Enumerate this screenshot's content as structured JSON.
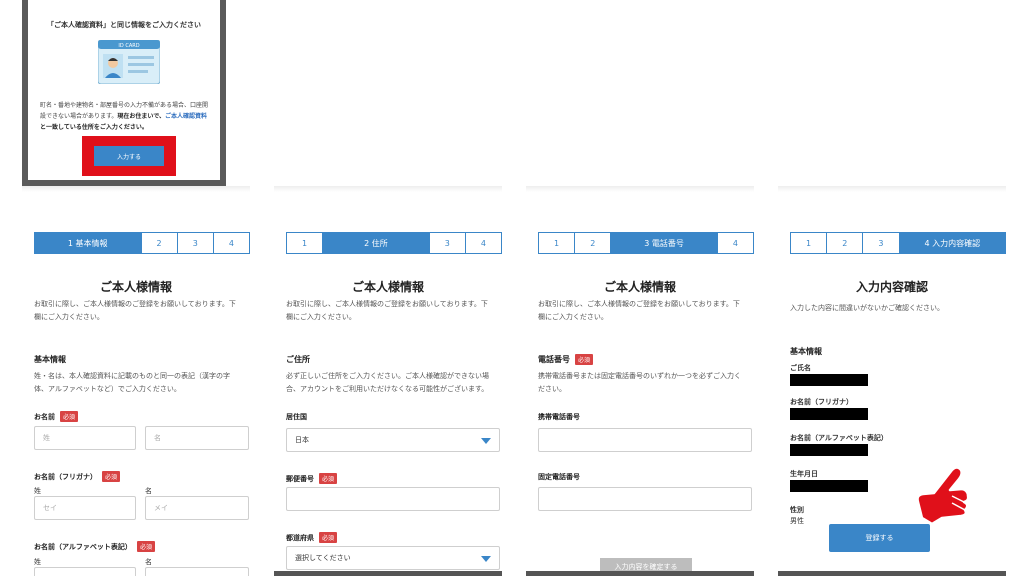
{
  "modal": {
    "title": "「ご本人確認資料」と同じ情報をご入力ください",
    "card_label": "ID CARD",
    "text_1": "町名・番地や建物名・部屋番号の入力不備がある場合、口座開設できない場合があります。",
    "text_bold": "現在お住まいで、",
    "text_blue": "ご本人確認資料",
    "text_bold_2": "と一致している住所をご入力ください。",
    "button": "入力する"
  },
  "panel1": {
    "steps": [
      "1 基本情報",
      "2",
      "3",
      "4"
    ],
    "title": "ご本人様情報",
    "intro": "お取引に際し、ご本人様情報のご登録をお願いしております。下欄にご入力ください。",
    "section_title": "基本情報",
    "section_desc": "姓・名は、本人確認資料に記載のものと同一の表記（漢字の字体、アルファベットなど）でご入力ください。",
    "name_label": "お名前",
    "required": "必須",
    "last_placeholder": "姓",
    "first_placeholder": "名",
    "kana_label": "お名前（フリガナ）",
    "kana_sei": "姓",
    "kana_mei": "名",
    "kana_last_placeholder": "セイ",
    "kana_first_placeholder": "メイ",
    "alpha_label": "お名前（アルファベット表記）",
    "alpha_sei": "姓",
    "alpha_mei": "名"
  },
  "panel2": {
    "steps": [
      "1",
      "2 住所",
      "3",
      "4"
    ],
    "title": "ご本人様情報",
    "intro": "お取引に際し、ご本人様情報のご登録をお願いしております。下欄にご入力ください。",
    "section_title": "ご住所",
    "section_desc": "必ず正しいご住所をご入力ください。ご本人様確認ができない場合、アカウントをご利用いただけなくなる可能性がございます。",
    "country_label": "居住国",
    "country_value": "日本",
    "postal_label": "郵便番号",
    "required": "必須",
    "pref_label": "都道府県",
    "pref_value": "選択してください"
  },
  "panel3": {
    "steps": [
      "1",
      "2",
      "3 電話番号",
      "4"
    ],
    "title": "ご本人様情報",
    "intro": "お取引に際し、ご本人様情報のご登録をお願いしております。下欄にご入力ください。",
    "section_title": "電話番号",
    "required": "必須",
    "section_desc": "携帯電話番号または固定電話番号のいずれか一つを必ずご入力ください。",
    "mobile_label": "携帯電話番号",
    "landline_label": "固定電話番号",
    "confirm_button": "入力内容を確定する"
  },
  "panel4": {
    "steps": [
      "1",
      "2",
      "3",
      "4 入力内容確認"
    ],
    "title": "入力内容確認",
    "intro": "入力した内容に間違いがないかご確認ください。",
    "section_title": "基本情報",
    "name_label": "ご氏名",
    "kana_label": "お名前（フリガナ）",
    "alpha_label": "お名前（アルファベット表記）",
    "dob_label": "生年月日",
    "gender_label": "性別",
    "gender_value": "男性",
    "register_button": "登録する"
  },
  "colors": {
    "accent": "#3a86c8",
    "required": "#d84343",
    "highlight": "#e0101a",
    "pointer": "#e0101a"
  }
}
